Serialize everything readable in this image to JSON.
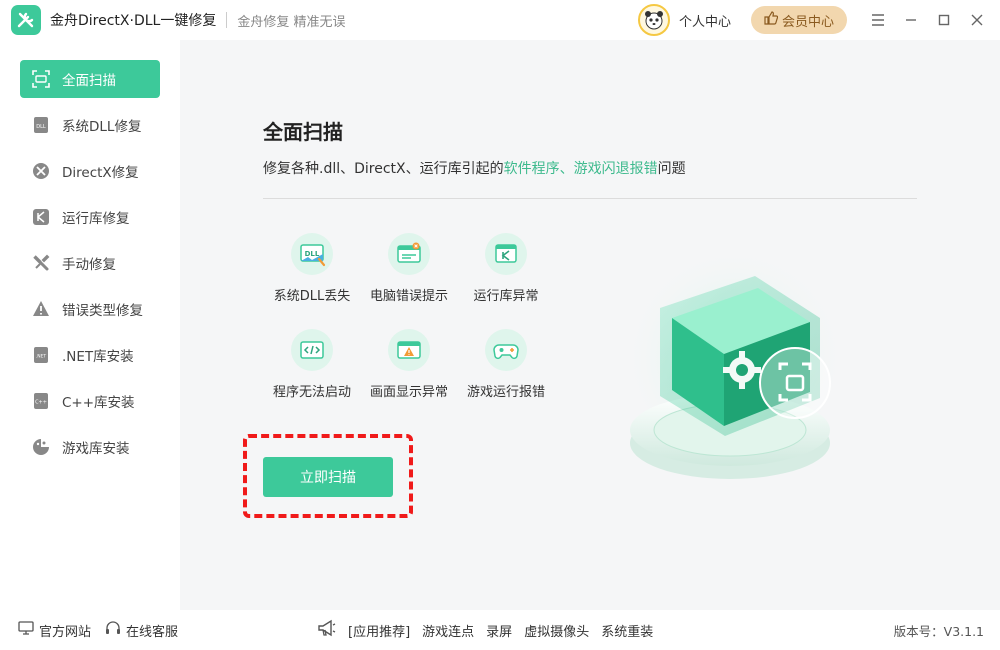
{
  "titlebar": {
    "app_title": "金舟DirectX·DLL一键修复",
    "slogan": "金舟修复 精准无误",
    "personal_center": "个人中心",
    "vip_center": "会员中心"
  },
  "sidebar": {
    "items": [
      {
        "label": "全面扫描",
        "icon": "scan-icon",
        "active": true
      },
      {
        "label": "系统DLL修复",
        "icon": "dll-icon"
      },
      {
        "label": "DirectX修复",
        "icon": "directx-icon"
      },
      {
        "label": "运行库修复",
        "icon": "runtime-icon"
      },
      {
        "label": "手动修复",
        "icon": "tools-icon"
      },
      {
        "label": "错误类型修复",
        "icon": "warning-icon"
      },
      {
        "label": ".NET库安装",
        "icon": "dotnet-icon"
      },
      {
        "label": "C++库安装",
        "icon": "cpp-icon"
      },
      {
        "label": "游戏库安装",
        "icon": "game-icon"
      }
    ]
  },
  "main": {
    "title": "全面扫描",
    "desc_prefix": "修复各种.dll、DirectX、运行库引起的",
    "desc_highlight": "软件程序、游戏闪退报错",
    "desc_suffix": "问题",
    "features": [
      {
        "label": "系统DLL丢失",
        "icon": "dll-missing-icon"
      },
      {
        "label": "电脑错误提示",
        "icon": "error-prompt-icon"
      },
      {
        "label": "运行库异常",
        "icon": "runtime-error-icon"
      },
      {
        "label": "程序无法启动",
        "icon": "code-icon"
      },
      {
        "label": "画面显示异常",
        "icon": "display-warning-icon"
      },
      {
        "label": "游戏运行报错",
        "icon": "gamepad-icon"
      }
    ],
    "scan_button": "立即扫描"
  },
  "footer": {
    "official_site": "官方网站",
    "online_service": "在线客服",
    "recommend_label": "[应用推荐]",
    "recommend_items": [
      "游戏连点",
      "录屏",
      "虚拟摄像头",
      "系统重装"
    ],
    "version": "版本号：V3.1.1"
  },
  "colors": {
    "accent": "#3dc99a",
    "highlight_text": "#3dba8d",
    "annotation_red": "#f01a1a",
    "vip_bg": "#f2d7ae"
  }
}
